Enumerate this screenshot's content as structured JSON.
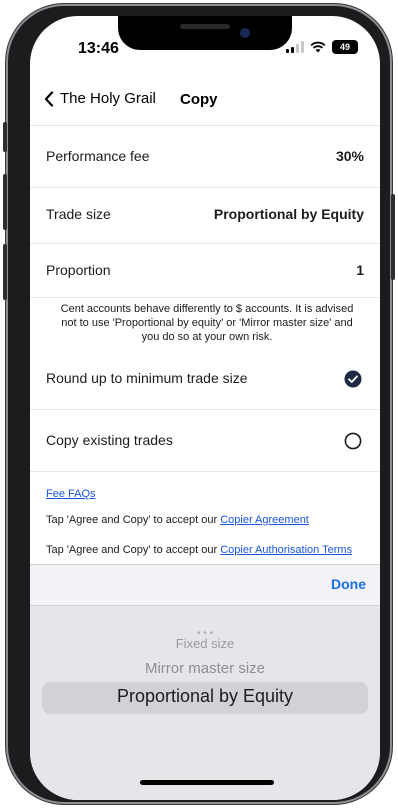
{
  "status": {
    "time": "13:46",
    "battery": "49"
  },
  "nav": {
    "back_label": "The Holy Grail",
    "title": "Copy"
  },
  "rows": {
    "performance_fee": {
      "label": "Performance fee",
      "value": "30%"
    },
    "trade_size": {
      "label": "Trade size",
      "value": "Proportional by Equity"
    },
    "proportion": {
      "label": "Proportion",
      "value": "1"
    }
  },
  "disclaimer": "Cent accounts behave differently to $ accounts. It is advised not to use 'Proportional by equity' or 'Mirror master size' and you do so at your own risk.",
  "options": {
    "round_up": {
      "label": "Round up to minimum trade size",
      "checked": true
    },
    "copy_existing": {
      "label": "Copy existing trades",
      "checked": false
    }
  },
  "links": {
    "fee_faqs": "Fee FAQs",
    "agreement_prefix": "Tap 'Agree and Copy' to accept our ",
    "agreement_link": "Copier Agreement",
    "authorisation_prefix": "Tap 'Agree and Copy' to accept our ",
    "authorisation_link": "Copier Authorisation Terms"
  },
  "picker": {
    "done_label": "Done",
    "items": [
      "Fixed size",
      "Mirror master size",
      "Proportional by Equity"
    ],
    "selected": "Proportional by Equity"
  },
  "colors": {
    "accent": "#1a6ee6",
    "link": "#1a55e3",
    "check": "#1c2a44"
  }
}
